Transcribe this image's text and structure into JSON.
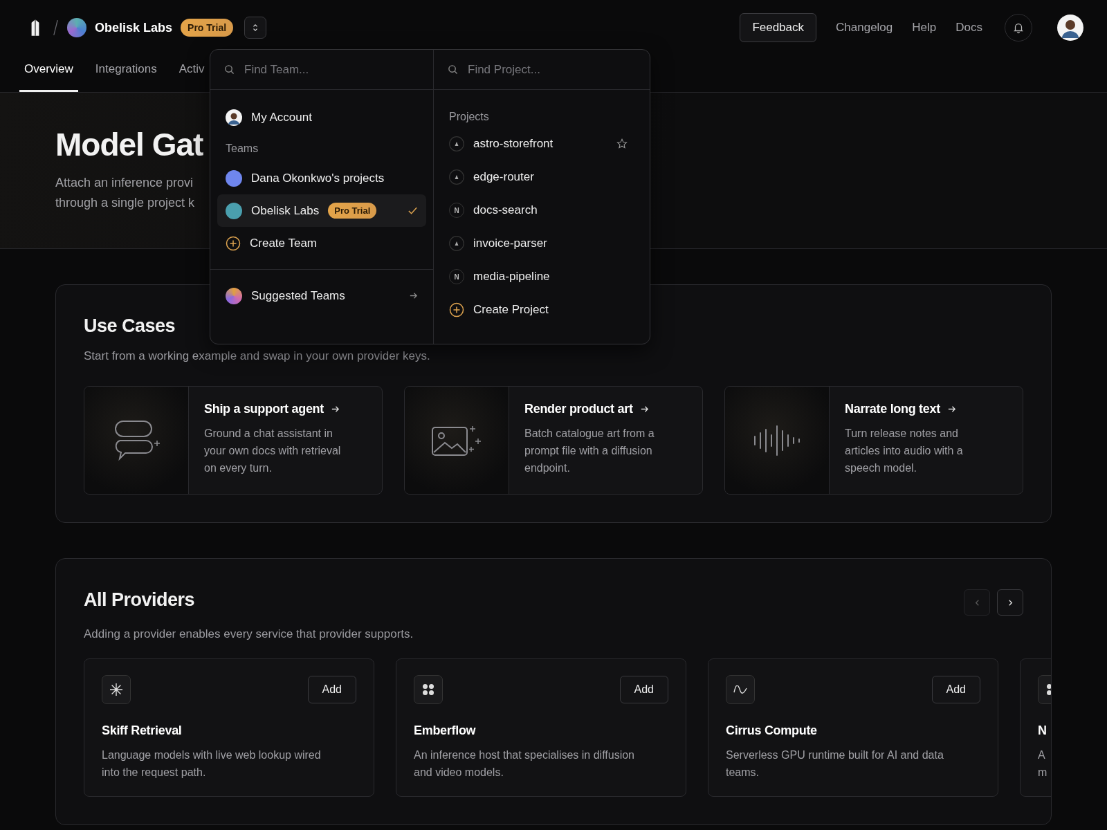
{
  "header": {
    "team_name": "Obelisk Labs",
    "plan_badge": "Pro Trial",
    "links": [
      {
        "label": "Feedback",
        "kind": "button"
      },
      {
        "label": "Changelog",
        "kind": "link"
      },
      {
        "label": "Help",
        "kind": "link"
      },
      {
        "label": "Docs",
        "kind": "link"
      }
    ]
  },
  "tabs": [
    {
      "label": "Overview",
      "selected": true
    },
    {
      "label": "Integrations",
      "selected": false
    },
    {
      "label": "Activ",
      "selected": false
    }
  ],
  "hero": {
    "title": "Model Gat",
    "description_lines": [
      "Attach an inference provi",
      "through a single project k"
    ]
  },
  "switcher": {
    "team_search": {
      "placeholder": "Find Team..."
    },
    "project_search": {
      "placeholder": "Find Project..."
    },
    "account": "My Account",
    "teams_label": "Teams",
    "teams": [
      {
        "name": "Dana Okonkwo's projects",
        "color": "#6f86ee",
        "selected": false
      },
      {
        "name": "Obelisk Labs",
        "color": "#4a9fae",
        "badge": "Pro Trial",
        "selected": true
      }
    ],
    "create_team": "Create Team",
    "suggested": "Suggested Teams",
    "projects_label": "Projects",
    "projects": [
      {
        "name": "astro-storefront",
        "kind": "triangle",
        "hovered": true
      },
      {
        "name": "edge-router",
        "kind": "triangle",
        "hovered": false
      },
      {
        "name": "docs-search",
        "kind": "letter",
        "letter": "N",
        "hovered": false
      },
      {
        "name": "invoice-parser",
        "kind": "triangle",
        "hovered": false
      },
      {
        "name": "media-pipeline",
        "kind": "letter",
        "letter": "N",
        "hovered": false
      }
    ],
    "create_project": "Create Project"
  },
  "use_cases": {
    "title": "Use Cases",
    "subtitle": "Start from a working example and swap in your own provider keys.",
    "cards": [
      {
        "title": "Ship a support agent",
        "description": "Ground a chat assistant in your own docs with retrieval on every turn.",
        "kind": "chat"
      },
      {
        "title": "Render product art",
        "description": "Batch catalogue art from a prompt file with a diffusion endpoint.",
        "kind": "image"
      },
      {
        "title": "Narrate long text",
        "description": "Turn release notes and articles into audio with a speech model.",
        "kind": "audio"
      }
    ]
  },
  "providers": {
    "title": "All Providers",
    "subtitle": "Adding a provider enables every service that provider supports.",
    "prev_disabled": true,
    "next_disabled": false,
    "cards": [
      {
        "name": "Skiff Retrieval",
        "description_lines": [
          "Language models with live web lookup wired",
          "into the request path."
        ],
        "kind": "asterisk",
        "action": "Add"
      },
      {
        "name": "Emberflow",
        "description_lines": [
          "An inference host that specialises in diffusion",
          "and video models."
        ],
        "kind": "dots",
        "action": "Add"
      },
      {
        "name": "Cirrus Compute",
        "description_lines": [
          "Serverless GPU runtime built for AI and data",
          "teams."
        ],
        "kind": "wave",
        "action": "Add"
      },
      {
        "name": "N",
        "description_lines": [
          "A",
          "m"
        ],
        "kind": "dots"
      }
    ]
  }
}
